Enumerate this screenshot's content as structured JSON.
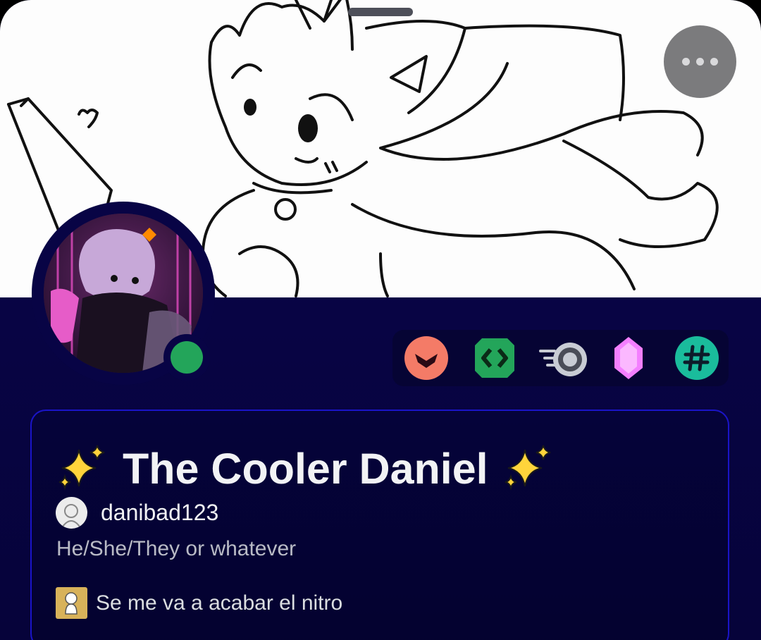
{
  "profile": {
    "display_name": "The Cooler Daniel",
    "display_name_decoration": "sparkles-emoji",
    "username": "danibad123",
    "pronouns": "He/She/They or whatever",
    "custom_status": "Se me va a acabar el nitro",
    "online_status": "online"
  },
  "badges": [
    {
      "name": "hypesquad-bravery-badge",
      "color": "#f47b67"
    },
    {
      "name": "active-developer-badge",
      "color": "#23a55a"
    },
    {
      "name": "nitro-boost-badge",
      "color": "#c8ccd4"
    },
    {
      "name": "server-booster-gem-badge",
      "color": "#f47fff"
    },
    {
      "name": "legacy-username-badge",
      "color": "#1abc9c"
    }
  ],
  "colors": {
    "profile_theme_primary": "#0a0650",
    "card_border_top": "#1a14c7",
    "card_border_bottom": "#b51a8a",
    "online": "#23a55a"
  }
}
